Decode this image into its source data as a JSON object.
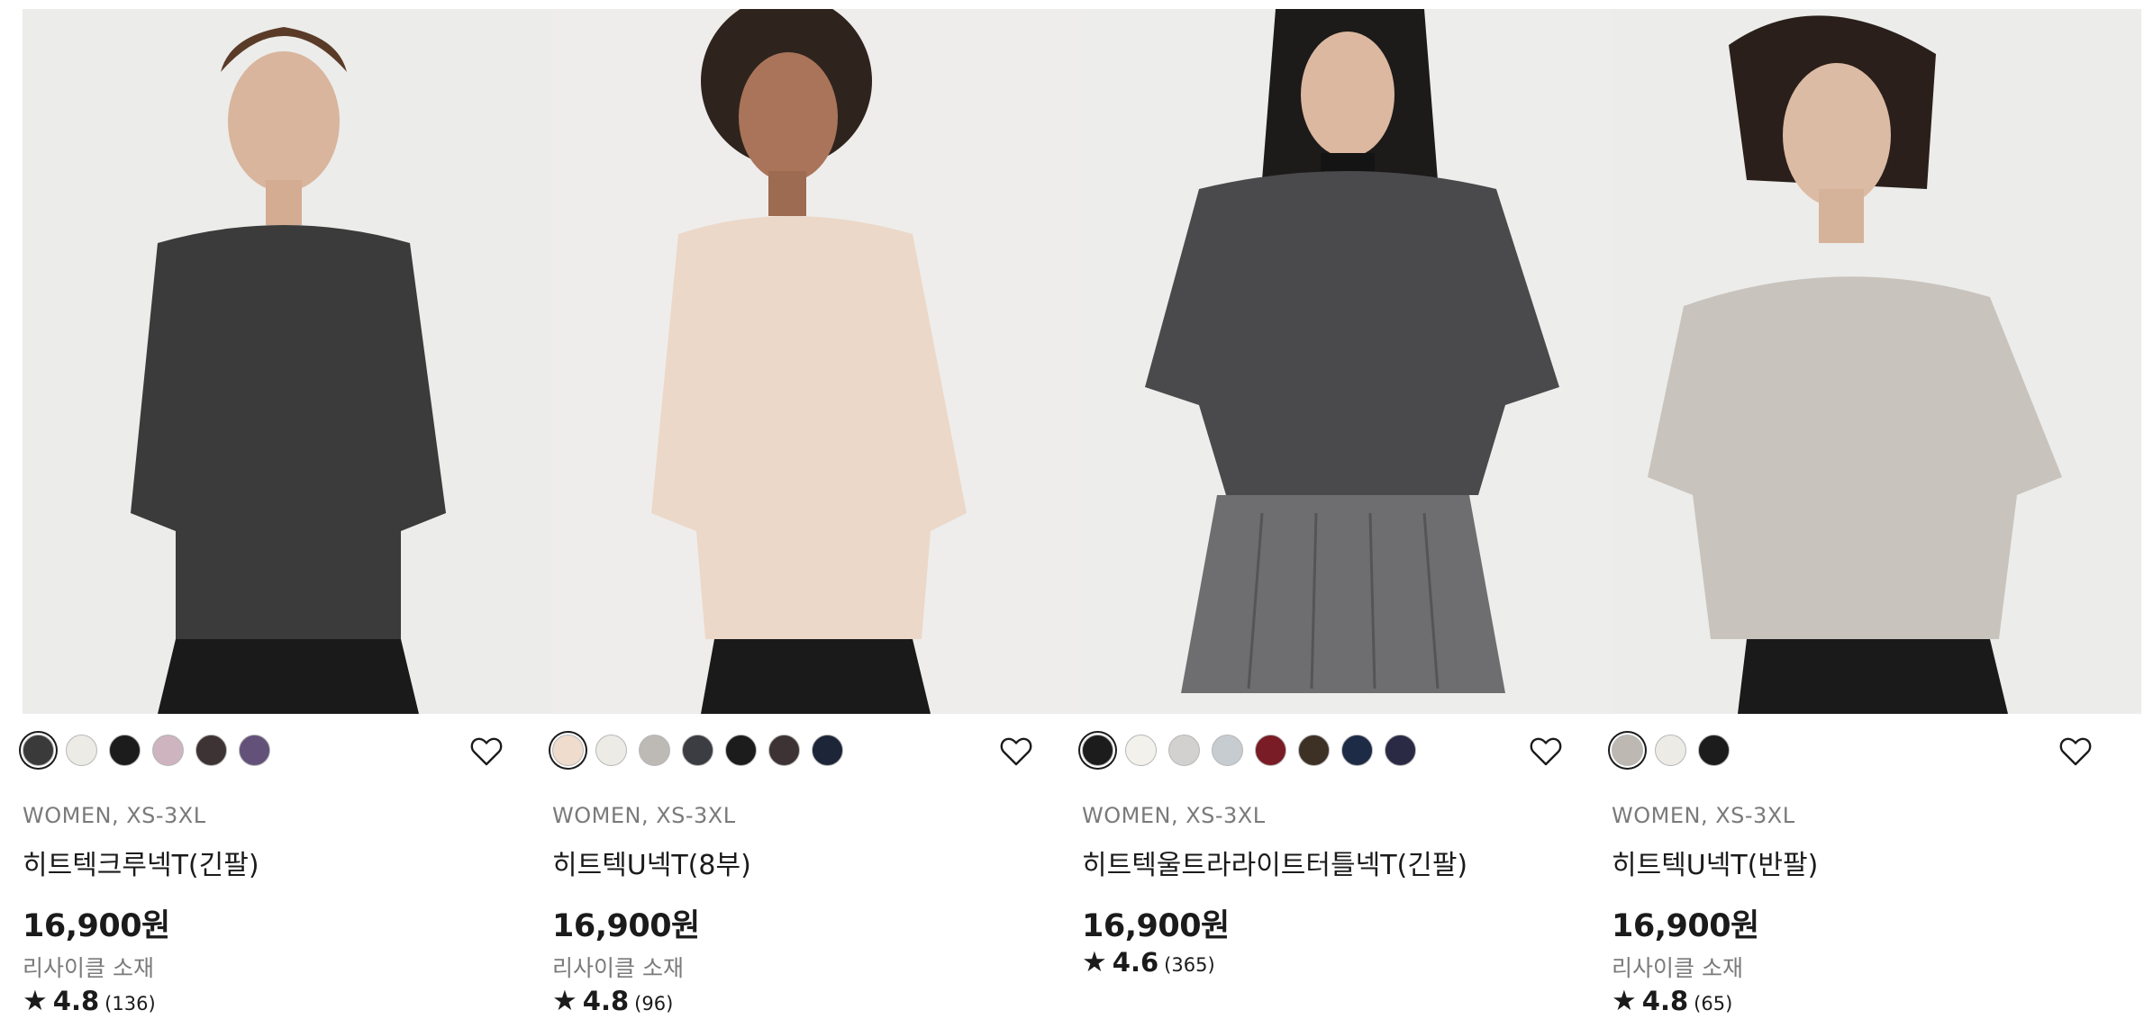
{
  "products": [
    {
      "meta": "WOMEN, XS-3XL",
      "name": "히트텍크루넥T(긴팔)",
      "price": "16,900원",
      "tag": "리사이클 소재",
      "rating": "4.8",
      "reviews": "(136)",
      "star": "★",
      "swatches": [
        "#3a3a3a",
        "#ecebe6",
        "#1c1c1c",
        "#cdb4bf",
        "#3e3334",
        "#63517a"
      ],
      "photo_bg": "#ececea",
      "garment": "#3b3b3b"
    },
    {
      "meta": "WOMEN, XS-3XL",
      "name": "히트텍U넥T(8부)",
      "price": "16,900원",
      "tag": "리사이클 소재",
      "rating": "4.8",
      "reviews": "(96)",
      "star": "★",
      "swatches": [
        "#f0dccd",
        "#ecebe6",
        "#bdbab6",
        "#3c3d42",
        "#1c1c1c",
        "#3e3334",
        "#1d2638"
      ],
      "photo_bg": "#eeedeb",
      "garment": "#ecd8c8"
    },
    {
      "meta": "WOMEN, XS-3XL",
      "name": "히트텍울트라라이트터틀넥T(긴팔)",
      "price": "16,900원",
      "rating": "4.6",
      "reviews": "(365)",
      "star": "★",
      "swatches": [
        "#1c1c1c",
        "#f3f1ec",
        "#d2d1cf",
        "#c7ccd1",
        "#7a1c25",
        "#3d3125",
        "#1e2b46",
        "#2b2a45"
      ],
      "photo_bg": "#ededeb",
      "garment": "#4a4a4c"
    },
    {
      "meta": "WOMEN, XS-3XL",
      "name": "히트텍U넥T(반팔)",
      "price": "16,900원",
      "tag": "리사이클 소재",
      "rating": "4.8",
      "reviews": "(65)",
      "star": "★",
      "swatches": [
        "#bdb8b2",
        "#ecebe6",
        "#1c1c1c"
      ],
      "photo_bg": "#ececea",
      "garment": "#c9c3bd"
    }
  ],
  "icons": {
    "wishlist": "heart-icon",
    "rating": "star-icon"
  }
}
